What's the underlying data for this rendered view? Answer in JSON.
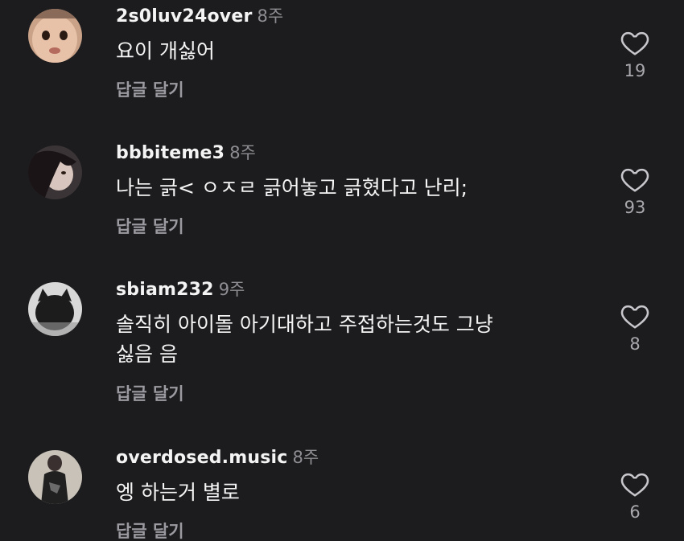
{
  "comments": [
    {
      "username": "2s0luv24over",
      "time": "8주",
      "text": "요이 개싫어",
      "reply_label": "답글 달기",
      "likes": "19",
      "avatar_icon": "avatar-face-icon"
    },
    {
      "username": "bbbiteme3",
      "time": "8주",
      "text": "나는 긁< ㅇㅈㄹ 긁어놓고 긁혔다고 난리;",
      "reply_label": "답글 달기",
      "likes": "93",
      "avatar_icon": "avatar-person-icon"
    },
    {
      "username": "sbiam232",
      "time": "9주",
      "text": "솔직히 아이돌 아기대하고 주접하는것도 그냥싫음 음",
      "reply_label": "답글 달기",
      "likes": "8",
      "avatar_icon": "avatar-cat-icon"
    },
    {
      "username": "overdosed.music",
      "time": "8주",
      "text": "엥 하는거 별로",
      "reply_label": "답글 달기",
      "likes": "6",
      "avatar_icon": "avatar-person-icon"
    }
  ],
  "colors": {
    "background": "#1c1c1e",
    "username": "#f4f4f4",
    "secondary": "#8e8e93"
  }
}
